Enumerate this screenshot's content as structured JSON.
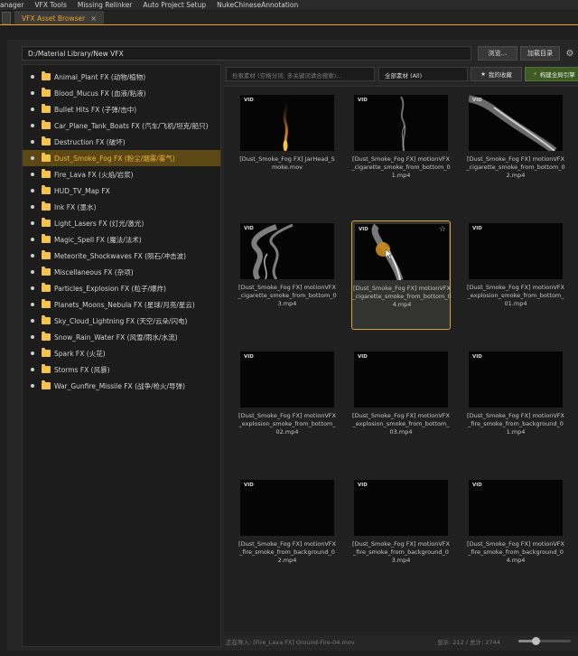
{
  "menubar": {
    "items": [
      "anager",
      "VFX Tools",
      "Missing Relinker",
      "Auto Project Setup",
      "NukeChineseAnnotation"
    ]
  },
  "tabbar": {
    "tab_label": "VFX Asset Browser",
    "close_glyph": "×"
  },
  "toolbar": {
    "path": "D:/Material Library/New VFX",
    "browse_label": "浏览...",
    "load_label": "加载目录",
    "settings_icon": "gear-icon"
  },
  "tree": {
    "selected_index": 5,
    "items": [
      {
        "label": "Animal_Plant FX (动物/植物)"
      },
      {
        "label": "Blood_Mucus FX (血液/粘液)"
      },
      {
        "label": "Bullet Hits FX (子弹/击中)"
      },
      {
        "label": "Car_Plane_Tank_Boats FX (汽车/飞机/坦克/船只)"
      },
      {
        "label": "Destruction FX (破坏)"
      },
      {
        "label": "Dust_Smoke_Fog FX (粉尘/烟雾/雾气)"
      },
      {
        "label": "Fire_Lava FX (火焰/岩浆)"
      },
      {
        "label": "HUD_TV_Map FX"
      },
      {
        "label": "Ink FX (墨水)"
      },
      {
        "label": "Light_Lasers FX (灯光/激光)"
      },
      {
        "label": "Magic_Spell FX (魔法/法术)"
      },
      {
        "label": "Meteorite_Shockwaves FX (陨石/冲击波)"
      },
      {
        "label": "Miscellaneous FX (杂项)"
      },
      {
        "label": "Particles_Explosion FX (粒子/爆炸)"
      },
      {
        "label": "Planets_Moons_Nebula FX (星球/月亮/星云)"
      },
      {
        "label": "Sky_Cloud_Lightning FX (天空/云朵/闪电)"
      },
      {
        "label": "Snow_Rain_Water FX (风雪/雨水/水流)"
      },
      {
        "label": "Spark FX (火花)"
      },
      {
        "label": "Storms FX (风暴)"
      },
      {
        "label": "War_Gunfire_Missile FX (战争/枪火/导弹)"
      }
    ]
  },
  "filters": {
    "search_placeholder": "检索素材 (空格分词, 多关键词请合搜索)...",
    "category_value": "全部素材 (All)",
    "favorites_label": "我的收藏",
    "build_label": "构建全局引擎",
    "favorites_icon": "star-icon",
    "build_icon": "lightning-icon"
  },
  "assets": [
    {
      "badge": "VID",
      "caption": "[Dust_Smoke_Fog FX] JarHead_Smoke.mov",
      "thumb": "candle"
    },
    {
      "badge": "VID",
      "caption": "[Dust_Smoke_Fog FX] motionVFX_cigarette_smoke_from_bottom_01.mp4",
      "thumb": "thin"
    },
    {
      "badge": "VID",
      "caption": "[Dust_Smoke_Fog FX] motionVFX_cigarette_smoke_from_bottom_02.mp4",
      "thumb": "curve"
    },
    {
      "badge": "VID",
      "caption": "[Dust_Smoke_Fog FX] motionVFX_cigarette_smoke_from_bottom_03.mp4",
      "thumb": "swirl"
    },
    {
      "badge": "VID",
      "caption": "[Dust_Smoke_Fog FX] motionVFX_cigarette_smoke_from_bottom_04.mp4",
      "thumb": "plume",
      "selected": true,
      "star": "☆"
    },
    {
      "badge": "VID",
      "caption": "[Dust_Smoke_Fog FX] motionVFX_explosion_smoke_from_bottom_01.mp4",
      "thumb": "black"
    },
    {
      "badge": "VID",
      "caption": "[Dust_Smoke_Fog FX] motionVFX_explosion_smoke_from_bottom_02.mp4",
      "thumb": "black"
    },
    {
      "badge": "VID",
      "caption": "[Dust_Smoke_Fog FX] motionVFX_explosion_smoke_from_bottom_03.mp4",
      "thumb": "black"
    },
    {
      "badge": "VID",
      "caption": "[Dust_Smoke_Fog FX] motionVFX_fire_smoke_from_background_01.mp4",
      "thumb": "black"
    },
    {
      "badge": "VID",
      "caption": "[Dust_Smoke_Fog FX] motionVFX_fire_smoke_from_background_02.mp4",
      "thumb": "black"
    },
    {
      "badge": "VID",
      "caption": "[Dust_Smoke_Fog FX] motionVFX_fire_smoke_from_background_03.mp4",
      "thumb": "black"
    },
    {
      "badge": "VID",
      "caption": "[Dust_Smoke_Fog FX] motionVFX_fire_smoke_from_background_04.mp4",
      "thumb": "black"
    }
  ],
  "status": {
    "left": "正在导入: [Fire_Lava FX] Ground-Fire-04.mov",
    "right": "显示: 212 / 总计: 2744",
    "zoom_fraction": 0.32
  },
  "colors": {
    "accent": "#f0a01e",
    "selected_row": "#5c4815",
    "build_button": "#3d5a26",
    "folder": "#f3c34c"
  }
}
